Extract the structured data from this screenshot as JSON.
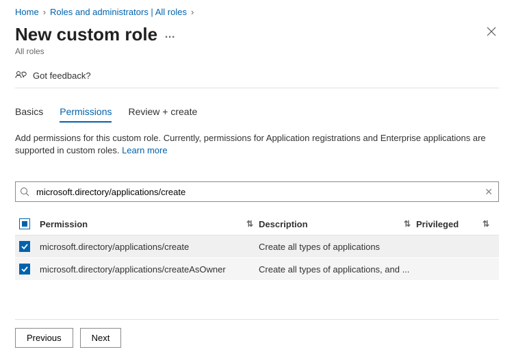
{
  "breadcrumb": {
    "home": "Home",
    "roles": "Roles and administrators | All roles"
  },
  "page": {
    "title": "New custom role",
    "subtitle": "All roles",
    "feedback": "Got feedback?"
  },
  "tabs": {
    "basics": "Basics",
    "permissions": "Permissions",
    "review": "Review + create"
  },
  "description": {
    "text": "Add permissions for this custom role. Currently, permissions for Application registrations and Enterprise applications are supported in custom roles. ",
    "learn_more": "Learn more"
  },
  "search": {
    "value": "microsoft.directory/applications/create"
  },
  "table": {
    "headers": {
      "permission": "Permission",
      "description": "Description",
      "privileged": "Privileged"
    },
    "rows": [
      {
        "permission": "microsoft.directory/applications/create",
        "description": "Create all types of applications"
      },
      {
        "permission": "microsoft.directory/applications/createAsOwner",
        "description": "Create all types of applications, and ..."
      }
    ]
  },
  "footer": {
    "previous": "Previous",
    "next": "Next"
  }
}
